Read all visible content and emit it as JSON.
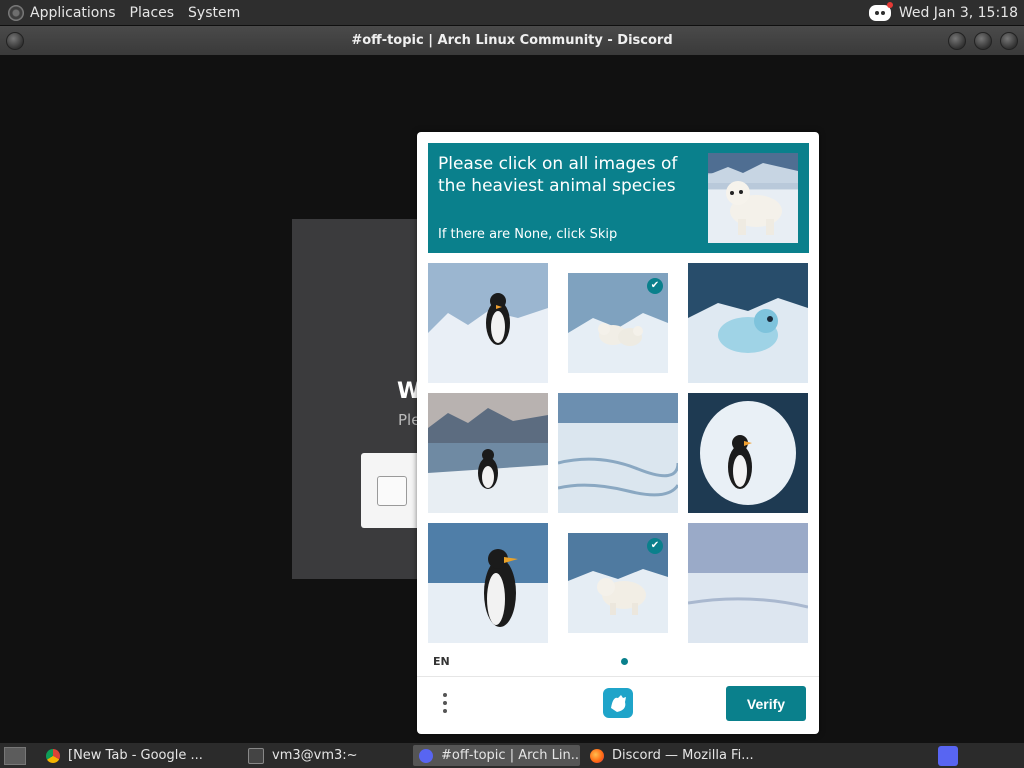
{
  "top_panel": {
    "menus": [
      "Applications",
      "Places",
      "System"
    ],
    "clock": "Wed Jan  3, 15:18"
  },
  "window": {
    "title": "#off-topic | Arch Linux Community - Discord"
  },
  "background_dialog": {
    "title_fragment": "W",
    "subtitle_fragment": "Ple"
  },
  "captcha": {
    "prompt": "Please click on all images of the heaviest animal species",
    "hint": "If there are None, click Skip",
    "language": "EN",
    "verify_label": "Verify",
    "tiles": [
      {
        "subject": "penguin",
        "selected": false
      },
      {
        "subject": "polar-bear-cubs",
        "selected": true
      },
      {
        "subject": "seal",
        "selected": false
      },
      {
        "subject": "penguin",
        "selected": false
      },
      {
        "subject": "ice",
        "selected": false
      },
      {
        "subject": "penguin",
        "selected": false
      },
      {
        "subject": "penguin",
        "selected": false
      },
      {
        "subject": "polar-bear",
        "selected": true
      },
      {
        "subject": "ice",
        "selected": false
      }
    ],
    "accent_color": "#0a808c"
  },
  "taskbar": {
    "items": [
      {
        "label": "[New Tab - Google ...",
        "icon": "chrome-icon",
        "active": false
      },
      {
        "label": "vm3@vm3:~",
        "icon": "terminal-icon",
        "active": false
      },
      {
        "label": "#off-topic | Arch Lin...",
        "icon": "discord-icon",
        "active": true
      },
      {
        "label": "Discord — Mozilla Fi...",
        "icon": "firefox-icon",
        "active": false
      }
    ]
  }
}
